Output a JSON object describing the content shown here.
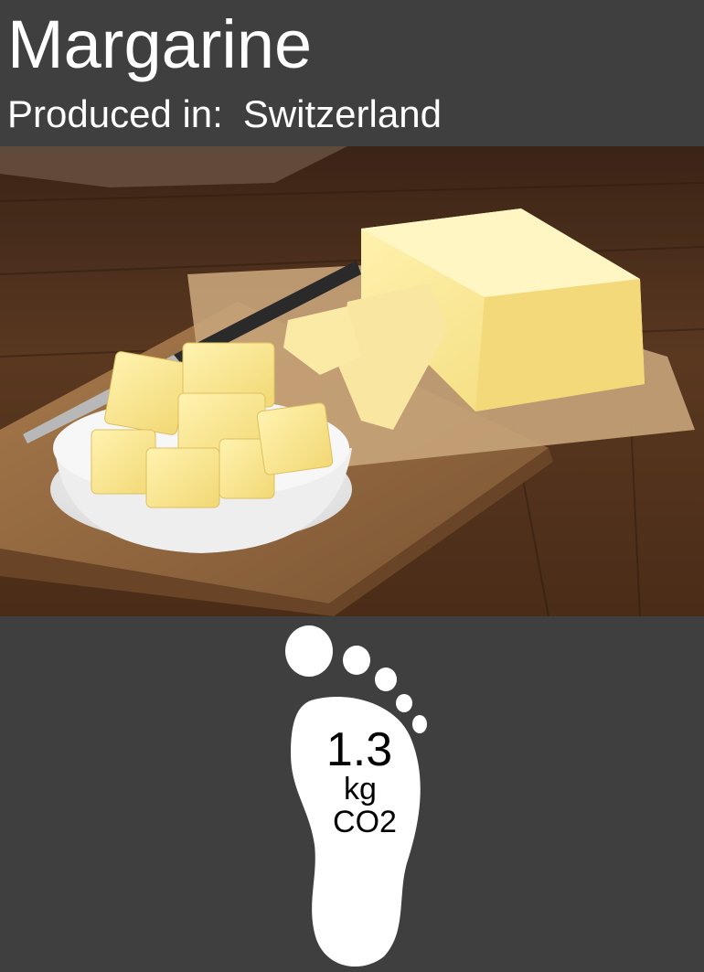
{
  "product": {
    "name": "Margarine",
    "origin_label": "Produced in:",
    "origin_country": "Switzerland"
  },
  "photo": {
    "subject": "butter block and cubes in a bowl on a wooden board"
  },
  "footprint": {
    "icon": "footprint-icon",
    "value": "1.3",
    "unit": "kg",
    "gas": "CO2"
  },
  "colors": {
    "background": "#3f3f3f",
    "text": "#ffffff",
    "footprint": "#ffffff"
  }
}
